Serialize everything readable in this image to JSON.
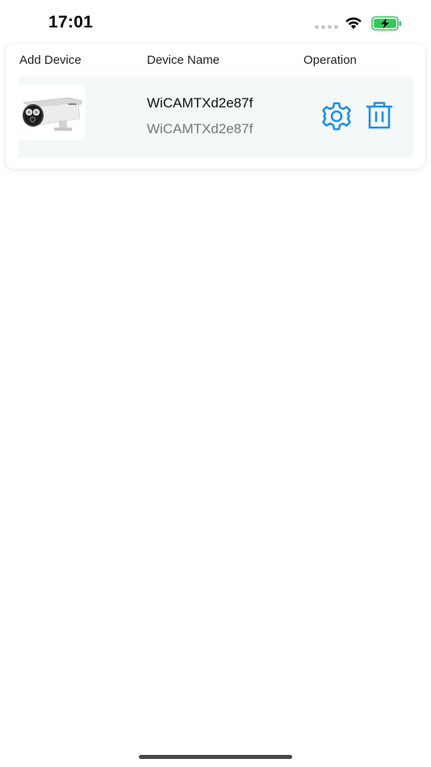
{
  "status_bar": {
    "time": "17:01",
    "battery_color": "#34c759"
  },
  "table": {
    "headers": {
      "add_device": "Add Device",
      "device_name": "Device Name",
      "operation": "Operation"
    },
    "devices": [
      {
        "name": "WiCAMTXd2e87f",
        "id": "WiCAMTXd2e87f",
        "thumbnail": "bullet-camera-image",
        "actions": [
          "gear-icon",
          "trash-icon"
        ]
      }
    ]
  },
  "colors": {
    "accent": "#1e8fe6",
    "row_bg": "#f4f8f9"
  }
}
